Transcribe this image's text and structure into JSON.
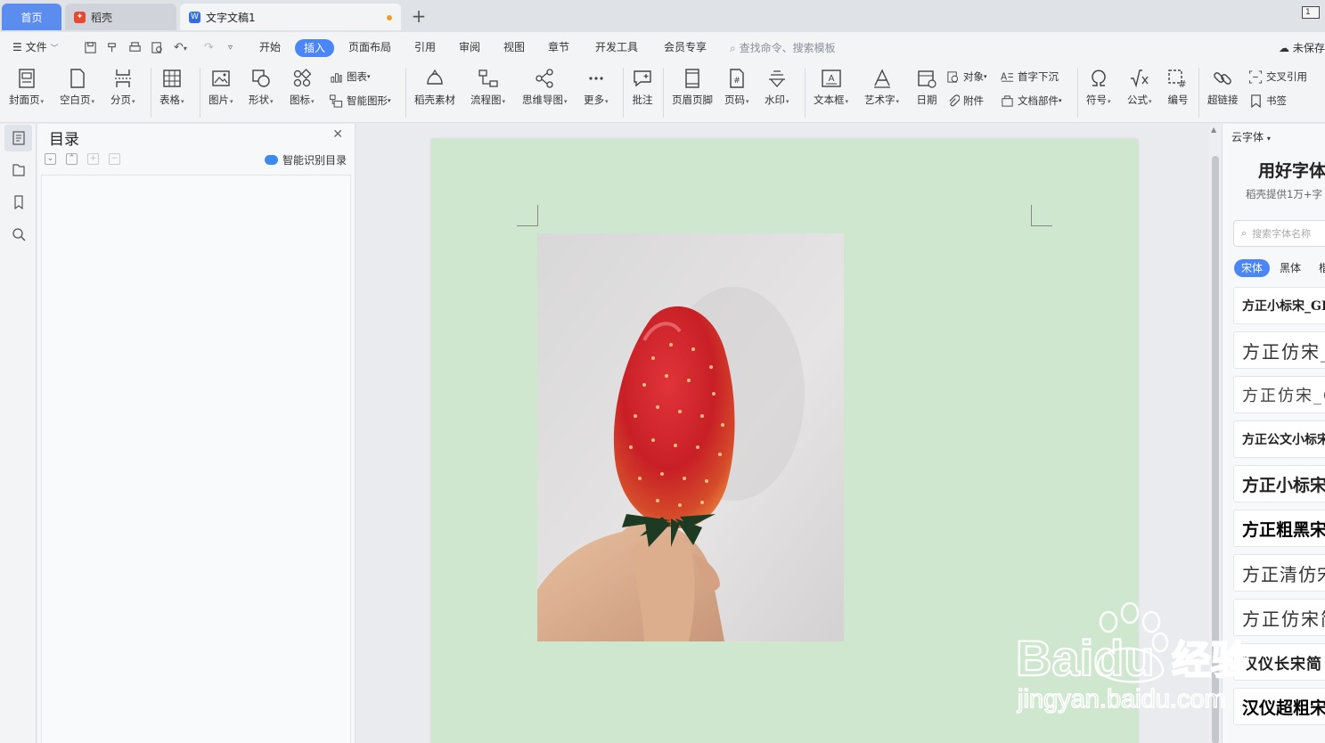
{
  "tabs": {
    "home": "首页",
    "docer": "稻壳",
    "doc": "文字文稿1"
  },
  "menu": {
    "file": "文件",
    "items": [
      "开始",
      "插入",
      "页面布局",
      "引用",
      "审阅",
      "视图",
      "章节",
      "开发工具",
      "会员专享"
    ],
    "search_placeholder": "查找命令、搜索模板",
    "unsaved": "未保存"
  },
  "ribbon": {
    "cover": "封面页",
    "blank": "空白页",
    "pagebreak": "分页",
    "table": "表格",
    "picture": "图片",
    "shape": "形状",
    "icon": "图标",
    "chart": "图表",
    "smartart": "智能图形",
    "material": "稻壳素材",
    "flowchart": "流程图",
    "mindmap": "思维导图",
    "more": "更多",
    "comment": "批注",
    "header_footer": "页眉页脚",
    "page_number": "页码",
    "watermark": "水印",
    "textbox": "文本框",
    "wordart": "艺术字",
    "date": "日期",
    "object": "对象",
    "attachment": "附件",
    "dropcap": "首字下沉",
    "docpart": "文档部件",
    "symbol": "符号",
    "formula": "公式",
    "numbering": "编号",
    "hyperlink": "超链接",
    "crossref": "交叉引用",
    "bookmark": "书签"
  },
  "toc": {
    "title": "目录",
    "smart_toc": "智能识别目录"
  },
  "font_panel": {
    "header": "云字体",
    "title": "用好字体",
    "subtitle": "稻壳提供1万+字",
    "search_placeholder": "搜索字体名称",
    "categories": [
      "宋体",
      "黑体",
      "楷"
    ],
    "fonts": [
      "方正小标宋_GB",
      "方正仿宋_",
      "方正仿宋_G",
      "方正公文小标宋",
      "方正小标宋",
      "方正粗黑宋",
      "方正清仿宋",
      "方正仿宋简",
      "汉仪长宋简",
      "汉仪超粗宋"
    ]
  },
  "watermark": {
    "brand": "Baidu",
    "cn": "经验",
    "url": "jingyan.baidu.com"
  },
  "colors": {
    "accent": "#4a86f7",
    "page": "#cfe7cf",
    "home_tab": "#5b8def"
  }
}
